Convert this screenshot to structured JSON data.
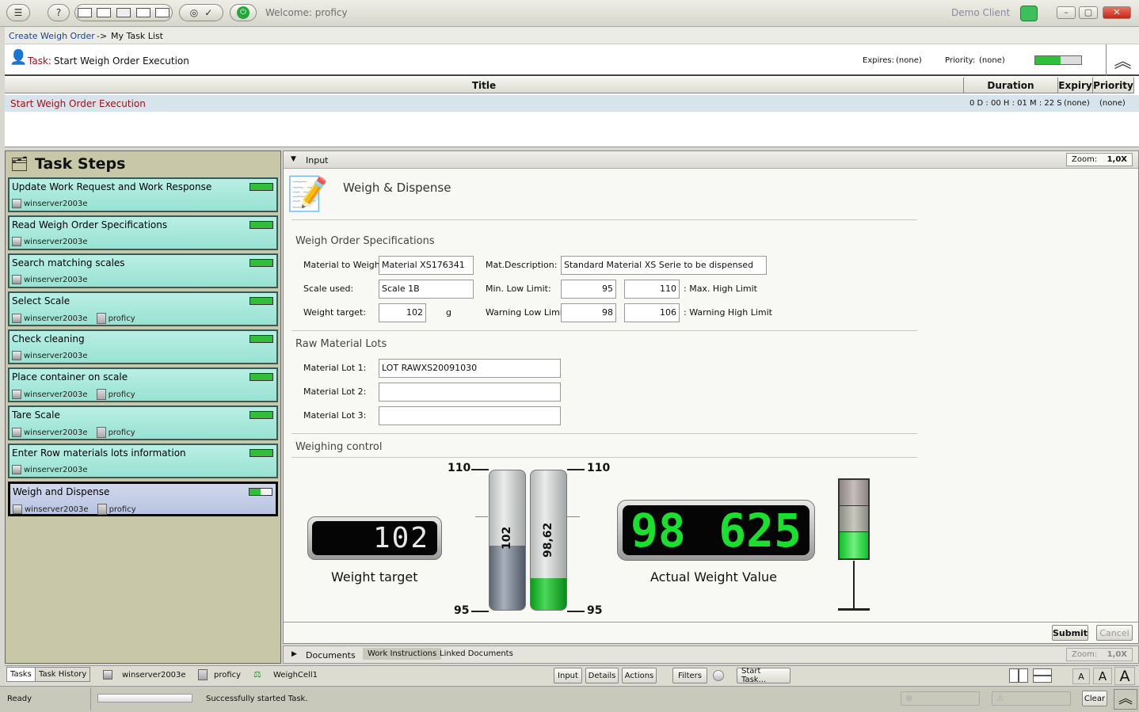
{
  "titlebar": {
    "welcome": "Welcome: proficy",
    "client": "Demo Client"
  },
  "breadcrumb": {
    "link": "Create Weigh Order",
    "sep": "->",
    "current": "My Task List"
  },
  "task": {
    "prefix": "Task:",
    "name": "Start Weigh Order Execution",
    "expires_label": "Expires:",
    "expires_value": "(none)",
    "priority_label": "Priority:",
    "priority_value": "(none)"
  },
  "grid": {
    "headers": [
      "Title",
      "Duration",
      "Expiry",
      "Priority"
    ],
    "row": {
      "title": "Start Weigh Order Execution",
      "duration": "0 D : 00 H : 01 M : 22 S",
      "expiry": "(none)",
      "priority": "(none)"
    }
  },
  "steps_panel": {
    "title": "Task Steps",
    "steps": [
      {
        "label": "Update Work Request and Work Response",
        "server": "winserver2003e",
        "user": ""
      },
      {
        "label": "Read Weigh Order Specifications",
        "server": "winserver2003e",
        "user": ""
      },
      {
        "label": "Search matching scales",
        "server": "winserver2003e",
        "user": ""
      },
      {
        "label": "Select Scale",
        "server": "winserver2003e",
        "user": "proficy"
      },
      {
        "label": "Check cleaning",
        "server": "winserver2003e",
        "user": ""
      },
      {
        "label": "Place container on scale",
        "server": "winserver2003e",
        "user": "proficy"
      },
      {
        "label": "Tare Scale",
        "server": "winserver2003e",
        "user": "proficy"
      },
      {
        "label": "Enter Row materials lots information",
        "server": "winserver2003e",
        "user": ""
      },
      {
        "label": "Weigh and Dispense",
        "server": "winserver2003e",
        "user": "proficy"
      }
    ]
  },
  "input_panel": {
    "header": "Input",
    "zoom_label": "Zoom:",
    "zoom_value": "1,0X",
    "form_title": "Weigh & Dispense",
    "spec_section": "Weigh Order Specifications",
    "material_label": "Material to Weigh:",
    "material_value": "Material XS176341",
    "desc_label": "Mat.Description:",
    "desc_value": "Standard Material XS Serie to be dispensed",
    "scale_label": "Scale used:",
    "scale_value": "Scale 1B",
    "min_low_label": "Min. Low Limit:",
    "min_low_value": "95",
    "max_high_value": "110",
    "max_high_label": ": Max. High Limit",
    "target_label": "Weight target:",
    "target_value": "102",
    "target_unit": "g",
    "warn_low_label": "Warning Low Limit:",
    "warn_low_value": "98",
    "warn_high_value": "106",
    "warn_high_label": ": Warning High Limit",
    "lots_section": "Raw Material Lots",
    "lot1_label": "Material Lot 1:",
    "lot1_value": "LOT RAWXS20091030",
    "lot2_label": "Material Lot 2:",
    "lot2_value": "",
    "lot3_label": "Material Lot 3:",
    "lot3_value": "",
    "control_section": "Weighing control",
    "gauge_top_left": "110",
    "gauge_top_right": "110",
    "gauge_bottom_left": "95",
    "gauge_bottom_right": "95",
    "bar1_value": "102",
    "bar2_value": "98,62",
    "target_display": "102",
    "target_caption": "Weight target",
    "actual_display_int": "98",
    "actual_display_dec": "625",
    "actual_caption": "Actual Weight Value",
    "submit": "Submit",
    "cancel": "Cancel"
  },
  "documents_bar": {
    "label": "Documents",
    "tab1": "Work Instructions",
    "tab2": "Linked Documents",
    "zoom_label": "Zoom:",
    "zoom_value": "1,0X"
  },
  "bottombar": {
    "tab_tasks": "Tasks",
    "tab_history": "Task History",
    "server": "winserver2003e",
    "user": "proficy",
    "cell": "WeighCell1",
    "btn_input": "Input",
    "btn_details": "Details",
    "btn_actions": "Actions",
    "btn_filters": "Filters",
    "btn_start": "Start Task...",
    "font_a1": "A",
    "font_a2": "A",
    "font_a3": "A"
  },
  "status": {
    "ready": "Ready",
    "message": "Successfully started Task.",
    "clear": "Clear"
  },
  "colors": {
    "accent_red": "#a0101a",
    "step_bg": "#a8e8da",
    "active_step_bg": "#c8d4ec",
    "led_green": "#18e02c"
  }
}
